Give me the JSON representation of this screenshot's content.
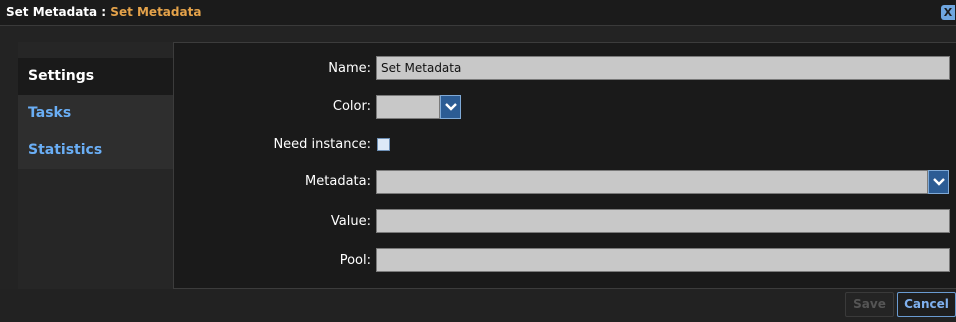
{
  "window": {
    "title_prefix": "Set Metadata : ",
    "title_name": "Set Metadata",
    "close_glyph": "X"
  },
  "sidebar": {
    "items": [
      {
        "label": "Settings"
      },
      {
        "label": "Tasks"
      },
      {
        "label": "Statistics"
      }
    ]
  },
  "form": {
    "name": {
      "label": "Name:",
      "value": "Set Metadata"
    },
    "color": {
      "label": "Color:"
    },
    "need_instance": {
      "label": "Need instance:"
    },
    "metadata": {
      "label": "Metadata:",
      "value": ""
    },
    "value": {
      "label": "Value:",
      "value": ""
    },
    "pool": {
      "label": "Pool:",
      "value": ""
    }
  },
  "buttons": {
    "save": "Save",
    "cancel": "Cancel"
  },
  "colors": {
    "accent": "#6aaef5",
    "title_highlight": "#e4a24a",
    "field_bg": "#c8c8c8"
  }
}
